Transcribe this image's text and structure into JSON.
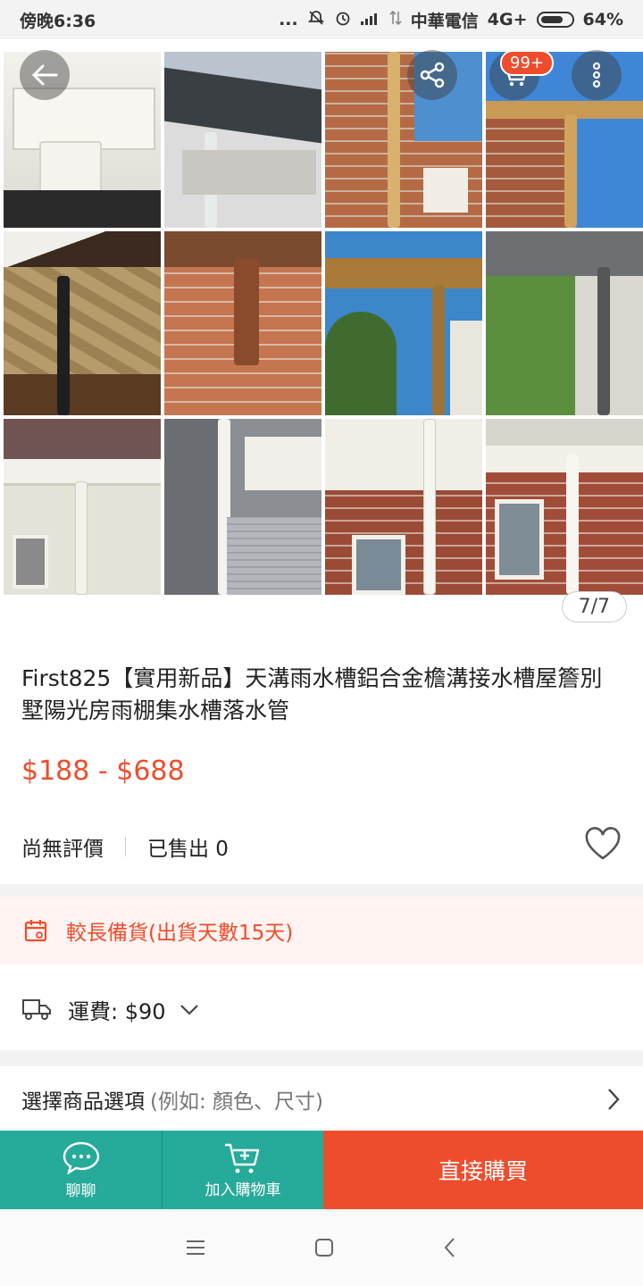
{
  "status_bar": {
    "time": "傍晚6:36",
    "dots": "...",
    "carrier": "中華電信",
    "network": "4G+",
    "battery": "64%"
  },
  "gallery": {
    "cart_badge": "99+",
    "counter": "7/7",
    "icons": [
      "back-arrow-icon",
      "share-icon",
      "cart-icon",
      "more-icon"
    ]
  },
  "product": {
    "title": "First825【實用新品】天溝雨水槽鋁合金檐溝接水槽屋簷別墅陽光房雨棚集水槽落水管",
    "price": "$188 - $688",
    "rating": "尚無評價",
    "sold": "已售出 0"
  },
  "preorder": {
    "text": "較長備貨(出貨天數15天)"
  },
  "shipping": {
    "text": "運費: $90"
  },
  "options": {
    "label": "選擇商品選項",
    "hint": "(例如: 顏色、尺寸)"
  },
  "action_bar": {
    "chat": "聊聊",
    "add_to_cart": "加入購物車",
    "buy_now": "直接購買"
  },
  "colors": {
    "accent": "#ee4d2d",
    "teal": "#26aa99"
  }
}
